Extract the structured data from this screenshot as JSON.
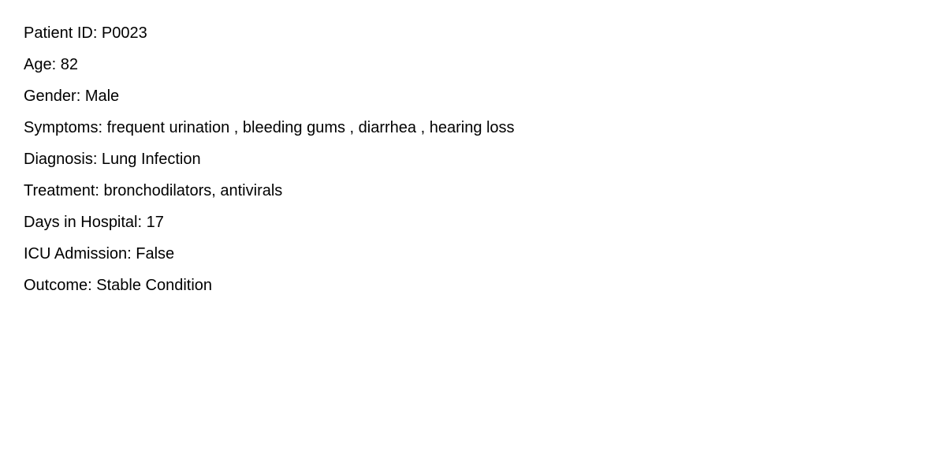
{
  "record": {
    "patient_id": "Patient ID: P0023",
    "age": "Age: 82",
    "gender": "Gender: Male",
    "symptoms": "Symptoms: frequent urination , bleeding gums , diarrhea , hearing loss",
    "diagnosis": "Diagnosis: Lung Infection",
    "treatment": "Treatment: bronchodilators, antivirals",
    "days_in_hospital": "Days in Hospital: 17",
    "icu_admission": "ICU Admission: False",
    "outcome": "Outcome: Stable Condition"
  }
}
